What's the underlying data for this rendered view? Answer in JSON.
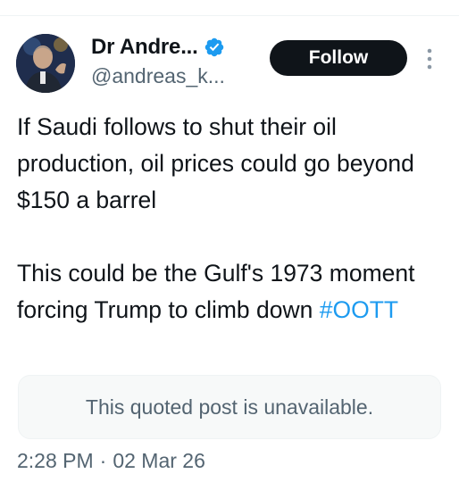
{
  "author": {
    "display_name": "Dr Andre...",
    "handle": "@andreas_k...",
    "avatar_icon": "avatar-photo",
    "verified_icon": "verified-badge-icon"
  },
  "actions": {
    "follow_label": "Follow",
    "more_icon": "more-vertical-icon"
  },
  "tweet": {
    "lines_paragraph_1": "If Saudi follows to shut their oil production, oil prices could go beyond $150 a barrel",
    "paragraph_2_text": "This could be the Gulf's 1973 moment forcing Trump to climb down ",
    "hashtag": "#OOTT"
  },
  "quote": {
    "text": "This quoted post is unavailable."
  },
  "meta": {
    "time": "2:28 PM",
    "separator": "·",
    "date": "02 Mar 26"
  },
  "colors": {
    "text": "#0f1419",
    "secondary": "#536471",
    "link": "#1d9bf0",
    "verified": "#1d9bf0",
    "follow_bg": "#0f1419"
  }
}
